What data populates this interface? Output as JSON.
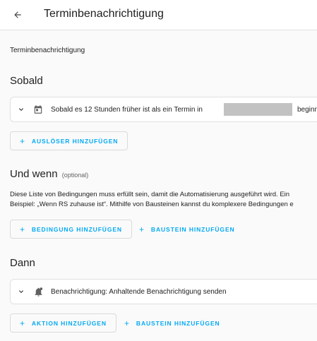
{
  "header": {
    "title": "Terminbenachrichtigung"
  },
  "breadcrumb": "Terminbenachrichtigung",
  "trigger_section": {
    "title": "Sobald",
    "card": {
      "text_before": "Sobald es 12 Stunden früher ist als ein Termin in",
      "text_after": "beginnt"
    },
    "add_trigger_label": "AUSLÖSER HINZUFÜGEN"
  },
  "condition_section": {
    "title": "Und wenn",
    "optional_label": "(optional)",
    "description_line1": "Diese Liste von Bedingungen muss erfüllt sein, damit die Automatisierung ausgeführt wird. Ein",
    "description_line2": "Beispiel: „Wenn RS zuhause ist“. Mithilfe von Bausteinen kannst du komplexere Bedingungen e",
    "add_condition_label": "BEDINGUNG HINZUFÜGEN",
    "add_block_label": "BAUSTEIN HINZUFÜGEN"
  },
  "action_section": {
    "title": "Dann",
    "card": {
      "text": "Benachrichtigung: Anhaltende Benachrichtigung senden"
    },
    "add_action_label": "AKTION HINZUFÜGEN",
    "add_block_label": "BAUSTEIN HINZUFÜGEN"
  },
  "icons": {
    "back": "arrow-left-icon",
    "chevron": "chevron-down-icon",
    "trigger": "calendar-icon",
    "action": "bell-alert-icon",
    "plus": "plus-icon"
  },
  "colors": {
    "accent": "#03a9f4",
    "background": "#fafafa",
    "card": "#ffffff",
    "redaction": "#c2c2c2"
  }
}
